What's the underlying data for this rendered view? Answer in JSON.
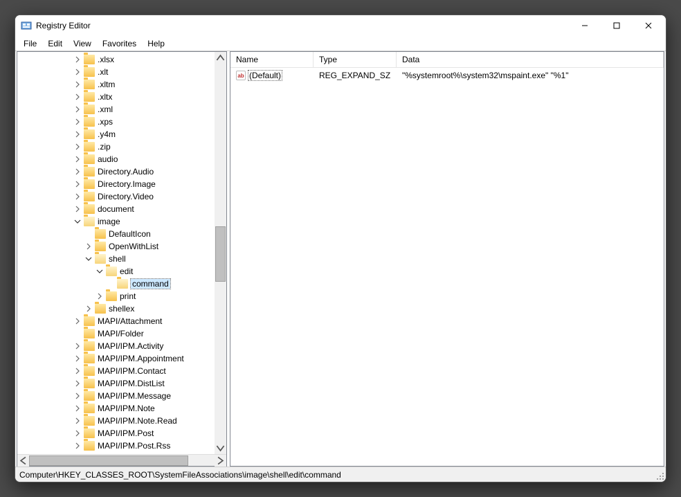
{
  "window": {
    "title": "Registry Editor"
  },
  "menu": {
    "file": "File",
    "edit": "Edit",
    "view": "View",
    "favorites": "Favorites",
    "help": "Help"
  },
  "tree": [
    {
      "indent": 5,
      "exp": "closed",
      "label": ".xlsx"
    },
    {
      "indent": 5,
      "exp": "closed",
      "label": ".xlt"
    },
    {
      "indent": 5,
      "exp": "closed",
      "label": ".xltm"
    },
    {
      "indent": 5,
      "exp": "closed",
      "label": ".xltx"
    },
    {
      "indent": 5,
      "exp": "closed",
      "label": ".xml"
    },
    {
      "indent": 5,
      "exp": "closed",
      "label": ".xps"
    },
    {
      "indent": 5,
      "exp": "closed",
      "label": ".y4m"
    },
    {
      "indent": 5,
      "exp": "closed",
      "label": ".zip"
    },
    {
      "indent": 5,
      "exp": "closed",
      "label": "audio"
    },
    {
      "indent": 5,
      "exp": "closed",
      "label": "Directory.Audio"
    },
    {
      "indent": 5,
      "exp": "closed",
      "label": "Directory.Image"
    },
    {
      "indent": 5,
      "exp": "closed",
      "label": "Directory.Video"
    },
    {
      "indent": 5,
      "exp": "closed",
      "label": "document"
    },
    {
      "indent": 5,
      "exp": "open",
      "label": "image",
      "open": true
    },
    {
      "indent": 6,
      "exp": "none",
      "label": "DefaultIcon"
    },
    {
      "indent": 6,
      "exp": "closed",
      "label": "OpenWithList"
    },
    {
      "indent": 6,
      "exp": "open",
      "label": "shell",
      "open": true
    },
    {
      "indent": 7,
      "exp": "open",
      "label": "edit",
      "open": true
    },
    {
      "indent": 8,
      "exp": "none",
      "label": "command",
      "selected": true,
      "open": true
    },
    {
      "indent": 7,
      "exp": "closed",
      "label": "print"
    },
    {
      "indent": 6,
      "exp": "closed",
      "label": "shellex"
    },
    {
      "indent": 5,
      "exp": "closed",
      "label": "MAPI/Attachment"
    },
    {
      "indent": 5,
      "exp": "none",
      "label": "MAPI/Folder"
    },
    {
      "indent": 5,
      "exp": "closed",
      "label": "MAPI/IPM.Activity"
    },
    {
      "indent": 5,
      "exp": "closed",
      "label": "MAPI/IPM.Appointment"
    },
    {
      "indent": 5,
      "exp": "closed",
      "label": "MAPI/IPM.Contact"
    },
    {
      "indent": 5,
      "exp": "closed",
      "label": "MAPI/IPM.DistList"
    },
    {
      "indent": 5,
      "exp": "closed",
      "label": "MAPI/IPM.Message"
    },
    {
      "indent": 5,
      "exp": "closed",
      "label": "MAPI/IPM.Note"
    },
    {
      "indent": 5,
      "exp": "closed",
      "label": "MAPI/IPM.Note.Read"
    },
    {
      "indent": 5,
      "exp": "closed",
      "label": "MAPI/IPM.Post"
    },
    {
      "indent": 5,
      "exp": "closed",
      "label": "MAPI/IPM.Post.Rss"
    }
  ],
  "list": {
    "cols": {
      "name": "Name",
      "type": "Type",
      "data": "Data"
    },
    "rows": [
      {
        "name": "(Default)",
        "type": "REG_EXPAND_SZ",
        "data": "\"%systemroot%\\system32\\mspaint.exe\" \"%1\""
      }
    ]
  },
  "status": {
    "path": "Computer\\HKEY_CLASSES_ROOT\\SystemFileAssociations\\image\\shell\\edit\\command"
  }
}
